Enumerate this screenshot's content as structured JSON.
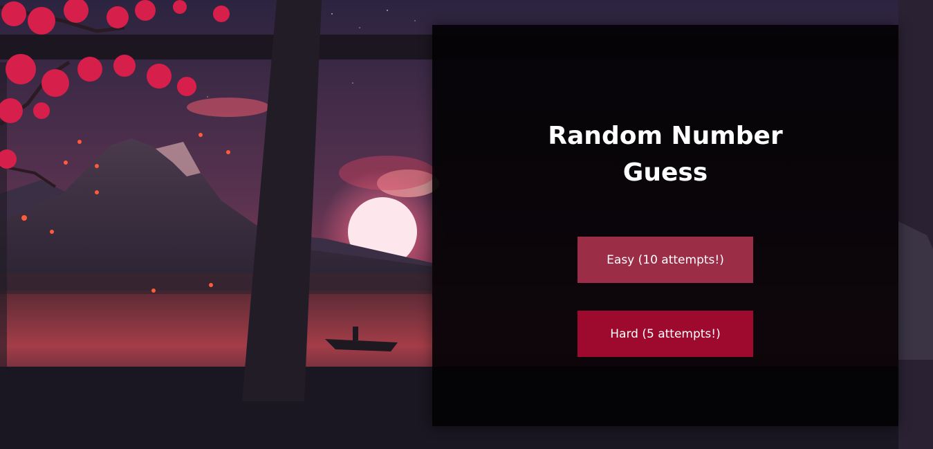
{
  "page": {
    "title_line1": "Random Number",
    "title_line2": "Guess"
  },
  "buttons": {
    "easy_label": "Easy (10 attempts!)",
    "hard_label": "Hard (5 attempts!)"
  },
  "colors": {
    "panel_background": "#030204",
    "easy_button": "#9b2d47",
    "hard_button": "#9e0a2e",
    "title_text": "#ffffff"
  },
  "background": {
    "description_icon": "sunset-mountain-window-scene"
  }
}
